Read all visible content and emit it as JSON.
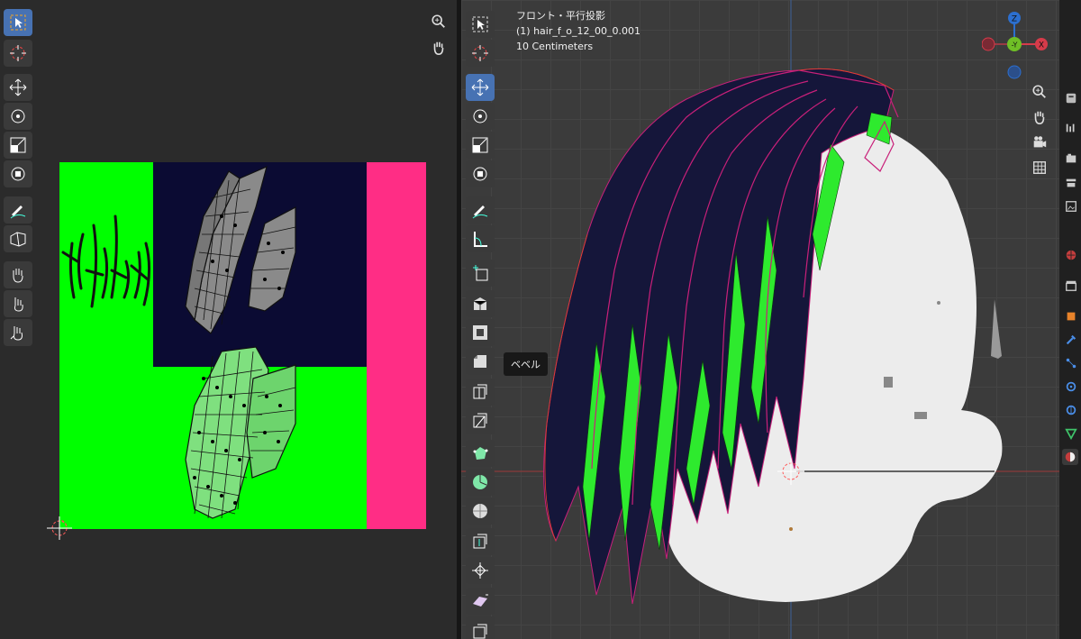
{
  "viewport": {
    "view_name": "フロント・平行投影",
    "object_name": "(1) hair_f_o_12_00_0.001",
    "scale": "10 Centimeters",
    "tooltip": "ベベル",
    "gizmo": {
      "z": "Z",
      "y": "-Y",
      "x": "X"
    }
  },
  "colors": {
    "uv_green": "#00ff00",
    "uv_navy": "#0b0b33",
    "uv_pink": "#ff2d85",
    "active_tool": "#4772b3",
    "gizmo_z": "#2c6fcf",
    "gizmo_y": "#6fbf26",
    "gizmo_x": "#d63b4a",
    "hair_dark": "#15163a",
    "face": "#ececec"
  },
  "uv_toolbar": [
    "select-box-icon",
    "cursor-icon",
    "move-icon",
    "rotate-icon",
    "scale-icon",
    "transform-icon",
    "annotate-icon",
    "rip-icon",
    "grab-icon",
    "relax-icon",
    "pinch-icon"
  ],
  "viewport_toolbar": [
    "select-box-icon",
    "cursor-icon",
    "move-icon",
    "rotate-icon",
    "scale-icon",
    "transform-icon",
    "annotate-icon",
    "measure-icon",
    "add-cube-icon",
    "extrude-icon",
    "inset-icon",
    "bevel-icon",
    "loop-cut-icon",
    "knife-icon",
    "poly-build-icon",
    "spin-icon",
    "smooth-icon",
    "edge-slide-icon",
    "shrink-icon",
    "shear-icon",
    "rip-region-icon"
  ],
  "props_icons": [
    "tool-icon",
    "render-icon",
    "output-icon",
    "view-layer-icon",
    "scene-icon",
    "world-icon",
    "collection-icon",
    "object-icon",
    "modifier-icon",
    "particles-icon",
    "physics-icon",
    "constraints-icon",
    "data-icon",
    "material-icon"
  ]
}
